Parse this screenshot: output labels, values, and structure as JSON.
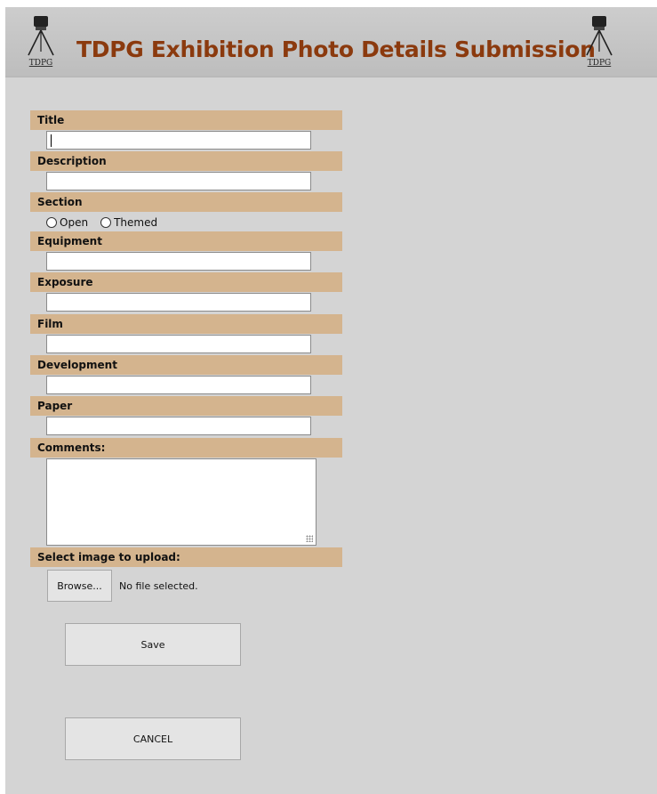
{
  "header": {
    "title": "TDPG Exhibition Photo Details Submission",
    "logo_text": "TDPG",
    "title_color": "#8b3a0e"
  },
  "form": {
    "title_label": "Title",
    "title_value": "",
    "description_label": "Description",
    "description_value": "",
    "section_label": "Section",
    "section_options": [
      "Open",
      "Themed"
    ],
    "equipment_label": "Equipment",
    "equipment_value": "",
    "exposure_label": "Exposure",
    "exposure_value": "",
    "film_label": "Film",
    "film_value": "",
    "development_label": "Development",
    "development_value": "",
    "paper_label": "Paper",
    "paper_value": "",
    "comments_label": "Comments:",
    "comments_value": "",
    "upload_label": "Select image to upload:",
    "browse_label": "Browse...",
    "no_file_text": "No file selected."
  },
  "actions": {
    "save_label": "Save",
    "cancel_label": "CANCEL"
  },
  "colors": {
    "label_bar": "#d4b48e",
    "page_background": "#d4d4d4"
  }
}
